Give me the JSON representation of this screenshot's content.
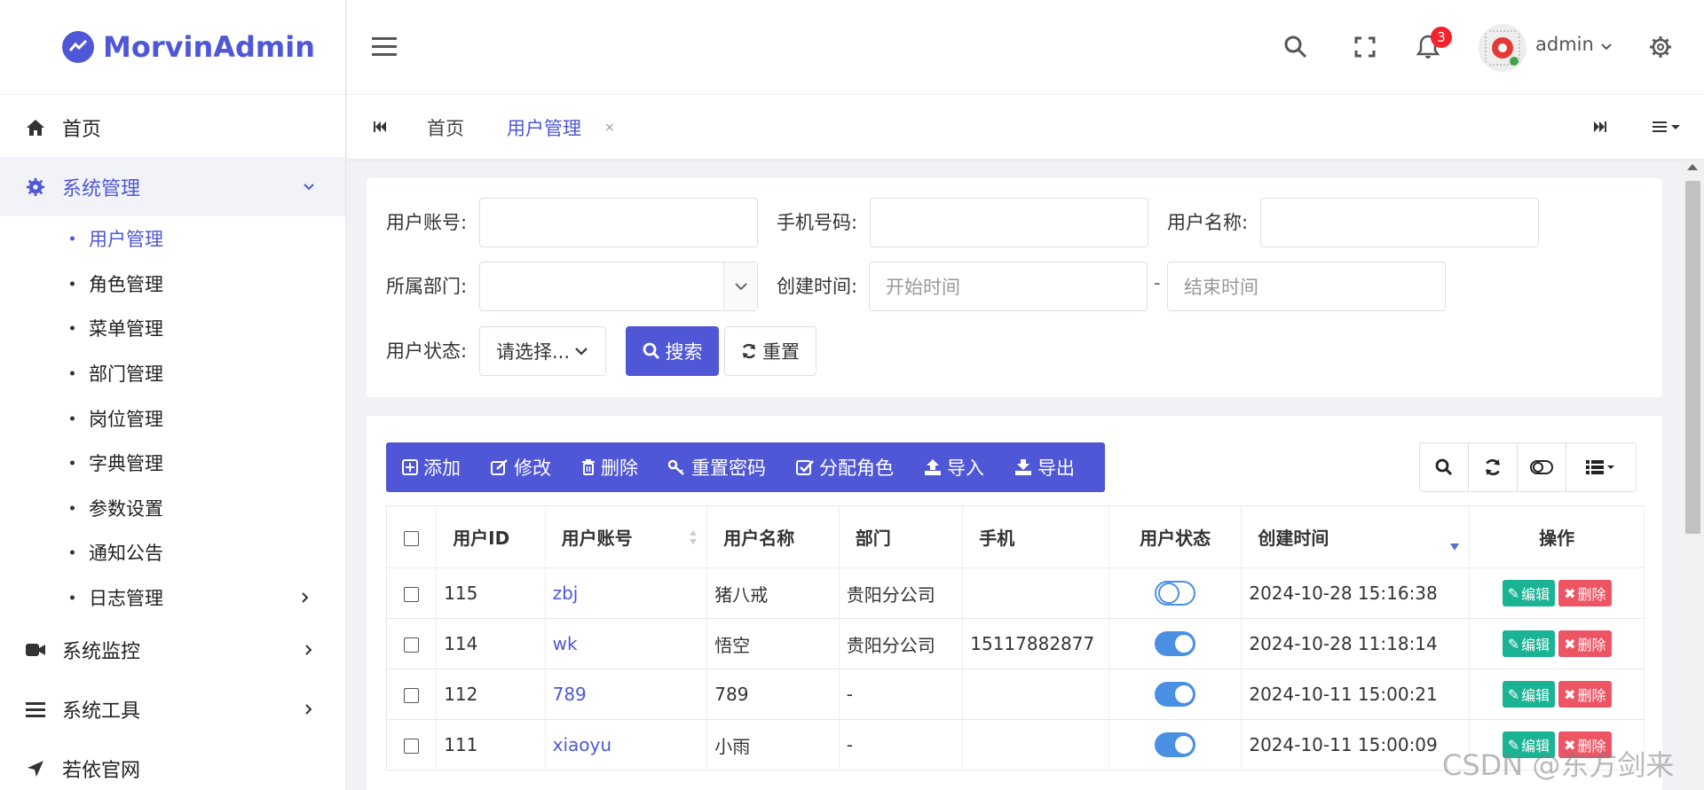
{
  "app": {
    "name": "MorvinAdmin",
    "brand_color": "#4f57d6"
  },
  "sidebar": {
    "items": [
      {
        "label": "首页",
        "icon": "home-icon"
      },
      {
        "label": "系统管理",
        "icon": "gear-icon",
        "expanded": true,
        "children": [
          {
            "label": "用户管理",
            "active": true
          },
          {
            "label": "角色管理"
          },
          {
            "label": "菜单管理"
          },
          {
            "label": "部门管理"
          },
          {
            "label": "岗位管理"
          },
          {
            "label": "字典管理"
          },
          {
            "label": "参数设置"
          },
          {
            "label": "通知公告"
          },
          {
            "label": "日志管理"
          }
        ]
      },
      {
        "label": "系统监控",
        "icon": "video-camera-icon"
      },
      {
        "label": "系统工具",
        "icon": "list-icon"
      },
      {
        "label": "若依官网",
        "icon": "location-arrow-icon"
      }
    ]
  },
  "header": {
    "notifications_count": "3",
    "username": "admin"
  },
  "tabs": {
    "items": [
      {
        "label": "首页"
      },
      {
        "label": "用户管理",
        "active": true,
        "close": "×"
      }
    ]
  },
  "search": {
    "user_account_label": "用户账号:",
    "phone_label": "手机号码:",
    "user_name_label": "用户名称:",
    "dept_label": "所属部门:",
    "created_label": "创建时间:",
    "start_placeholder": "开始时间",
    "range_sep": "-",
    "end_placeholder": "结束时间",
    "status_label": "用户状态:",
    "status_value": "请选择...",
    "search_button": "搜索",
    "reset_button": "重置"
  },
  "toolbar": {
    "add": "添加",
    "edit": "修改",
    "delete": "删除",
    "reset_password": "重置密码",
    "assign_role": "分配角色",
    "import": "导入",
    "export": "导出"
  },
  "table": {
    "columns": [
      "用户ID",
      "用户账号",
      "用户名称",
      "部门",
      "手机",
      "用户状态",
      "创建时间",
      "操作"
    ],
    "rows": [
      {
        "id": "115",
        "account": "zbj",
        "name": "猪八戒",
        "dept": "贵阳分公司",
        "phone": "",
        "status": "off",
        "created": "2024-10-28 15:16:38"
      },
      {
        "id": "114",
        "account": "wk",
        "name": "悟空",
        "dept": "贵阳分公司",
        "phone": "15117882877",
        "status": "on",
        "created": "2024-10-28 11:18:14"
      },
      {
        "id": "112",
        "account": "789",
        "name": "789",
        "dept": "-",
        "phone": "",
        "status": "on",
        "created": "2024-10-11 15:00:21"
      },
      {
        "id": "111",
        "account": "xiaoyu",
        "name": "小雨",
        "dept": "-",
        "phone": "",
        "status": "on",
        "created": "2024-10-11 15:00:09"
      }
    ],
    "edit_label": "编辑",
    "delete_label": "删除"
  },
  "watermark": "CSDN @东方剑来"
}
